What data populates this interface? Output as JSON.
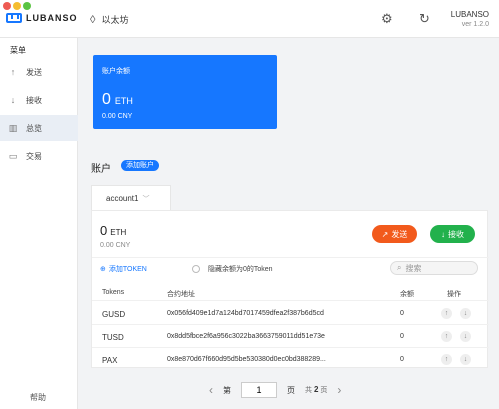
{
  "header": {
    "logo_text": "LUBANSO",
    "network": "以太坊",
    "app_name": "LUBANSO",
    "app_version": "ver 1.2.0",
    "icons": [
      "settings-icon",
      "refresh-icon"
    ]
  },
  "sidebar": {
    "title": "菜单",
    "items": [
      {
        "label": "发送",
        "icon": "send-icon"
      },
      {
        "label": "接收",
        "icon": "receive-icon"
      },
      {
        "label": "总览",
        "icon": "overview-icon",
        "active": true
      },
      {
        "label": "交易",
        "icon": "transactions-icon"
      }
    ],
    "help": "帮助"
  },
  "balance_card": {
    "title": "账户余额",
    "amount": "0",
    "unit": "ETH",
    "cny": "0.00 CNY",
    "color": "#1677ff"
  },
  "accounts": {
    "title": "账户",
    "add_label": "添加账户",
    "selected": "account1"
  },
  "account": {
    "amount": "0",
    "unit": "ETH",
    "cny": "0.00 CNY",
    "send_label": "发送",
    "receive_label": "接收",
    "send_color": "#f25a1c",
    "receive_color": "#22b14c"
  },
  "tokens": {
    "add_label": "添加TOKEN",
    "hide_zero_label": "隐藏余额为0的Token",
    "search_placeholder": "搜索",
    "columns": {
      "token": "Tokens",
      "address": "合约地址",
      "balance": "余额",
      "ops": "操作"
    },
    "rows": [
      {
        "token": "GUSD",
        "address": "0x056fd409e1d7a124bd7017459dfea2f387b6d5cd",
        "balance": "0"
      },
      {
        "token": "TUSD",
        "address": "0x8dd5fbce2f6a956c3022ba3663759011dd51e73e",
        "balance": "0"
      },
      {
        "token": "PAX",
        "address": "0x8e870d67f660d95d5be530380d0ec0bd388289...",
        "balance": "0"
      }
    ]
  },
  "pagination": {
    "prefix": "第",
    "current": "1",
    "suffix": "页",
    "total_prefix": "共",
    "total": "2",
    "total_suffix": "页"
  }
}
